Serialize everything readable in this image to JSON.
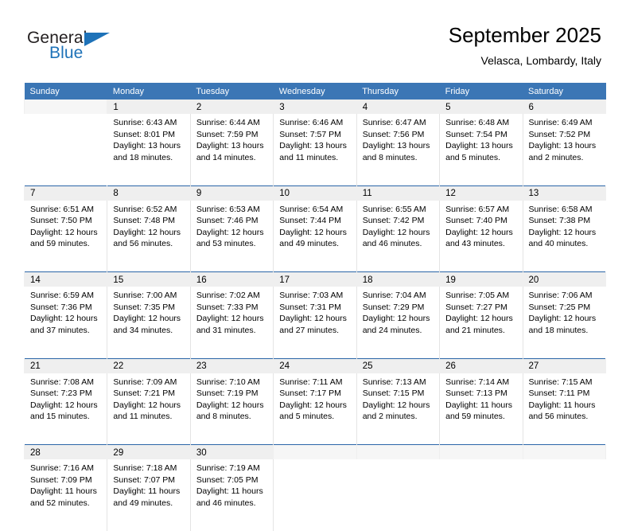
{
  "brand": {
    "name_top": "General",
    "name_bottom": "Blue",
    "accent_color": "#1e72b8",
    "logo_icon": "triangle-icon"
  },
  "header": {
    "title": "September 2025",
    "subtitle": "Velasca, Lombardy, Italy"
  },
  "theme": {
    "header_bg": "#3b76b5",
    "daynum_bg": "#efefef",
    "row_divider": "#2b66a8",
    "cell_divider": "#e4e4e4"
  },
  "weekdays": [
    "Sunday",
    "Monday",
    "Tuesday",
    "Wednesday",
    "Thursday",
    "Friday",
    "Saturday"
  ],
  "labels": {
    "sunrise_prefix": "Sunrise:",
    "sunset_prefix": "Sunset:",
    "daylight_prefix": "Daylight:"
  },
  "weeks": [
    [
      {
        "day": "",
        "l1": "",
        "l2": "",
        "l3": "",
        "l4": ""
      },
      {
        "day": "1",
        "l1": "Sunrise: 6:43 AM",
        "l2": "Sunset: 8:01 PM",
        "l3": "Daylight: 13 hours",
        "l4": "and 18 minutes."
      },
      {
        "day": "2",
        "l1": "Sunrise: 6:44 AM",
        "l2": "Sunset: 7:59 PM",
        "l3": "Daylight: 13 hours",
        "l4": "and 14 minutes."
      },
      {
        "day": "3",
        "l1": "Sunrise: 6:46 AM",
        "l2": "Sunset: 7:57 PM",
        "l3": "Daylight: 13 hours",
        "l4": "and 11 minutes."
      },
      {
        "day": "4",
        "l1": "Sunrise: 6:47 AM",
        "l2": "Sunset: 7:56 PM",
        "l3": "Daylight: 13 hours",
        "l4": "and 8 minutes."
      },
      {
        "day": "5",
        "l1": "Sunrise: 6:48 AM",
        "l2": "Sunset: 7:54 PM",
        "l3": "Daylight: 13 hours",
        "l4": "and 5 minutes."
      },
      {
        "day": "6",
        "l1": "Sunrise: 6:49 AM",
        "l2": "Sunset: 7:52 PM",
        "l3": "Daylight: 13 hours",
        "l4": "and 2 minutes."
      }
    ],
    [
      {
        "day": "7",
        "l1": "Sunrise: 6:51 AM",
        "l2": "Sunset: 7:50 PM",
        "l3": "Daylight: 12 hours",
        "l4": "and 59 minutes."
      },
      {
        "day": "8",
        "l1": "Sunrise: 6:52 AM",
        "l2": "Sunset: 7:48 PM",
        "l3": "Daylight: 12 hours",
        "l4": "and 56 minutes."
      },
      {
        "day": "9",
        "l1": "Sunrise: 6:53 AM",
        "l2": "Sunset: 7:46 PM",
        "l3": "Daylight: 12 hours",
        "l4": "and 53 minutes."
      },
      {
        "day": "10",
        "l1": "Sunrise: 6:54 AM",
        "l2": "Sunset: 7:44 PM",
        "l3": "Daylight: 12 hours",
        "l4": "and 49 minutes."
      },
      {
        "day": "11",
        "l1": "Sunrise: 6:55 AM",
        "l2": "Sunset: 7:42 PM",
        "l3": "Daylight: 12 hours",
        "l4": "and 46 minutes."
      },
      {
        "day": "12",
        "l1": "Sunrise: 6:57 AM",
        "l2": "Sunset: 7:40 PM",
        "l3": "Daylight: 12 hours",
        "l4": "and 43 minutes."
      },
      {
        "day": "13",
        "l1": "Sunrise: 6:58 AM",
        "l2": "Sunset: 7:38 PM",
        "l3": "Daylight: 12 hours",
        "l4": "and 40 minutes."
      }
    ],
    [
      {
        "day": "14",
        "l1": "Sunrise: 6:59 AM",
        "l2": "Sunset: 7:36 PM",
        "l3": "Daylight: 12 hours",
        "l4": "and 37 minutes."
      },
      {
        "day": "15",
        "l1": "Sunrise: 7:00 AM",
        "l2": "Sunset: 7:35 PM",
        "l3": "Daylight: 12 hours",
        "l4": "and 34 minutes."
      },
      {
        "day": "16",
        "l1": "Sunrise: 7:02 AM",
        "l2": "Sunset: 7:33 PM",
        "l3": "Daylight: 12 hours",
        "l4": "and 31 minutes."
      },
      {
        "day": "17",
        "l1": "Sunrise: 7:03 AM",
        "l2": "Sunset: 7:31 PM",
        "l3": "Daylight: 12 hours",
        "l4": "and 27 minutes."
      },
      {
        "day": "18",
        "l1": "Sunrise: 7:04 AM",
        "l2": "Sunset: 7:29 PM",
        "l3": "Daylight: 12 hours",
        "l4": "and 24 minutes."
      },
      {
        "day": "19",
        "l1": "Sunrise: 7:05 AM",
        "l2": "Sunset: 7:27 PM",
        "l3": "Daylight: 12 hours",
        "l4": "and 21 minutes."
      },
      {
        "day": "20",
        "l1": "Sunrise: 7:06 AM",
        "l2": "Sunset: 7:25 PM",
        "l3": "Daylight: 12 hours",
        "l4": "and 18 minutes."
      }
    ],
    [
      {
        "day": "21",
        "l1": "Sunrise: 7:08 AM",
        "l2": "Sunset: 7:23 PM",
        "l3": "Daylight: 12 hours",
        "l4": "and 15 minutes."
      },
      {
        "day": "22",
        "l1": "Sunrise: 7:09 AM",
        "l2": "Sunset: 7:21 PM",
        "l3": "Daylight: 12 hours",
        "l4": "and 11 minutes."
      },
      {
        "day": "23",
        "l1": "Sunrise: 7:10 AM",
        "l2": "Sunset: 7:19 PM",
        "l3": "Daylight: 12 hours",
        "l4": "and 8 minutes."
      },
      {
        "day": "24",
        "l1": "Sunrise: 7:11 AM",
        "l2": "Sunset: 7:17 PM",
        "l3": "Daylight: 12 hours",
        "l4": "and 5 minutes."
      },
      {
        "day": "25",
        "l1": "Sunrise: 7:13 AM",
        "l2": "Sunset: 7:15 PM",
        "l3": "Daylight: 12 hours",
        "l4": "and 2 minutes."
      },
      {
        "day": "26",
        "l1": "Sunrise: 7:14 AM",
        "l2": "Sunset: 7:13 PM",
        "l3": "Daylight: 11 hours",
        "l4": "and 59 minutes."
      },
      {
        "day": "27",
        "l1": "Sunrise: 7:15 AM",
        "l2": "Sunset: 7:11 PM",
        "l3": "Daylight: 11 hours",
        "l4": "and 56 minutes."
      }
    ],
    [
      {
        "day": "28",
        "l1": "Sunrise: 7:16 AM",
        "l2": "Sunset: 7:09 PM",
        "l3": "Daylight: 11 hours",
        "l4": "and 52 minutes."
      },
      {
        "day": "29",
        "l1": "Sunrise: 7:18 AM",
        "l2": "Sunset: 7:07 PM",
        "l3": "Daylight: 11 hours",
        "l4": "and 49 minutes."
      },
      {
        "day": "30",
        "l1": "Sunrise: 7:19 AM",
        "l2": "Sunset: 7:05 PM",
        "l3": "Daylight: 11 hours",
        "l4": "and 46 minutes."
      },
      {
        "day": "",
        "l1": "",
        "l2": "",
        "l3": "",
        "l4": ""
      },
      {
        "day": "",
        "l1": "",
        "l2": "",
        "l3": "",
        "l4": ""
      },
      {
        "day": "",
        "l1": "",
        "l2": "",
        "l3": "",
        "l4": ""
      },
      {
        "day": "",
        "l1": "",
        "l2": "",
        "l3": "",
        "l4": ""
      }
    ]
  ]
}
